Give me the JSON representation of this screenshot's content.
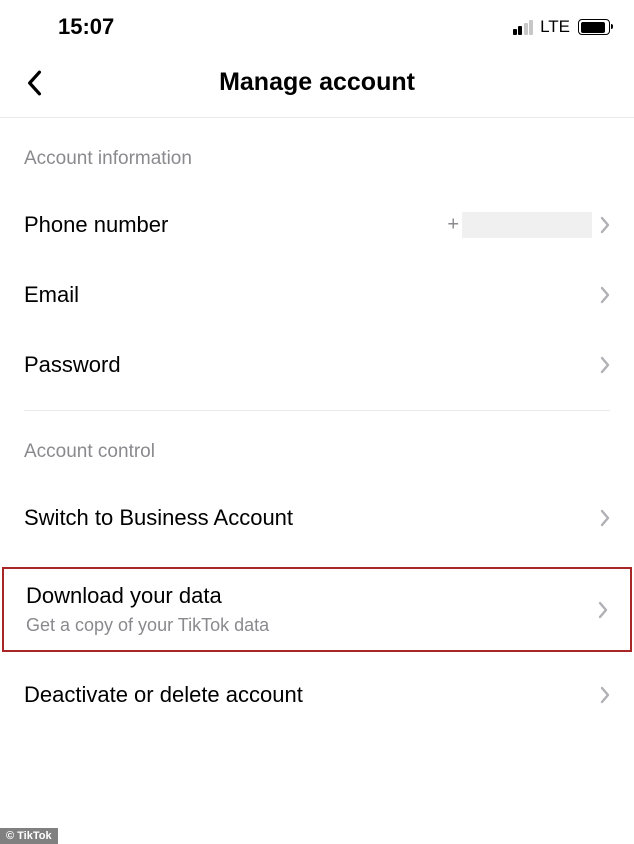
{
  "status": {
    "time": "15:07",
    "network": "LTE"
  },
  "header": {
    "title": "Manage account"
  },
  "sections": {
    "info": {
      "header": "Account information",
      "phone": {
        "label": "Phone number",
        "value_prefix": "+"
      },
      "email": {
        "label": "Email"
      },
      "password": {
        "label": "Password"
      }
    },
    "control": {
      "header": "Account control",
      "switch": {
        "label": "Switch to Business Account"
      },
      "download": {
        "label": "Download your data",
        "sub": "Get a copy of your TikTok data"
      },
      "deactivate": {
        "label": "Deactivate or delete account"
      }
    }
  },
  "watermark": "© TikTok"
}
